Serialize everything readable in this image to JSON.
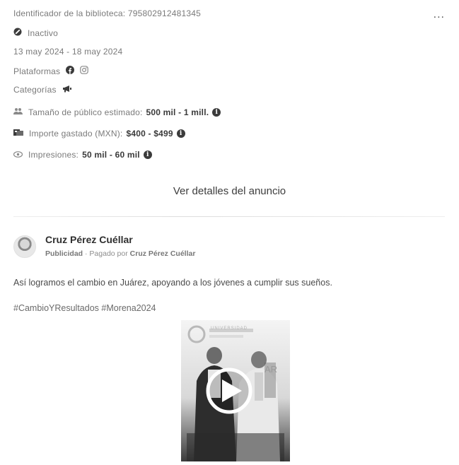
{
  "header": {
    "library_id": "Identificador de la biblioteca: 795802912481345",
    "more_label": "..."
  },
  "status": {
    "label": "Inactivo"
  },
  "dates": "13 may 2024 - 18 may 2024",
  "platforms": {
    "label": "Plataformas",
    "icons": [
      "facebook-icon",
      "instagram-icon"
    ]
  },
  "categories": {
    "label": "Categorías",
    "icons": [
      "megaphone-icon"
    ]
  },
  "audience": {
    "label": "Tamaño de público estimado:",
    "value": "500 mil - 1 mill."
  },
  "spend": {
    "label": "Importe gastado (MXN):",
    "value": "$400 - $499"
  },
  "impressions": {
    "label": "Impresiones:",
    "value": "50 mil - 60 mil"
  },
  "details_button": "Ver detalles del anuncio",
  "ad": {
    "advertiser_name": "Cruz Pérez Cuéllar",
    "sponsored_label": "Publicidad",
    "paid_by_prefix": "· Pagado por",
    "paid_by_name": "Cruz Pérez Cuéllar",
    "body": "Así logramos el cambio en Juárez, apoyando a los jóvenes a cumplir sus sueños.",
    "hashtags": "#CambioYResultados #Morena2024",
    "video_overlay_text_1": "UNIVERSIDAD",
    "video_overlay_text_2": "AR"
  },
  "colors": {
    "text": "#6b6b6b",
    "strong": "#3a3a3a",
    "icon": "#3b3b3b",
    "background": "#ffffff"
  }
}
